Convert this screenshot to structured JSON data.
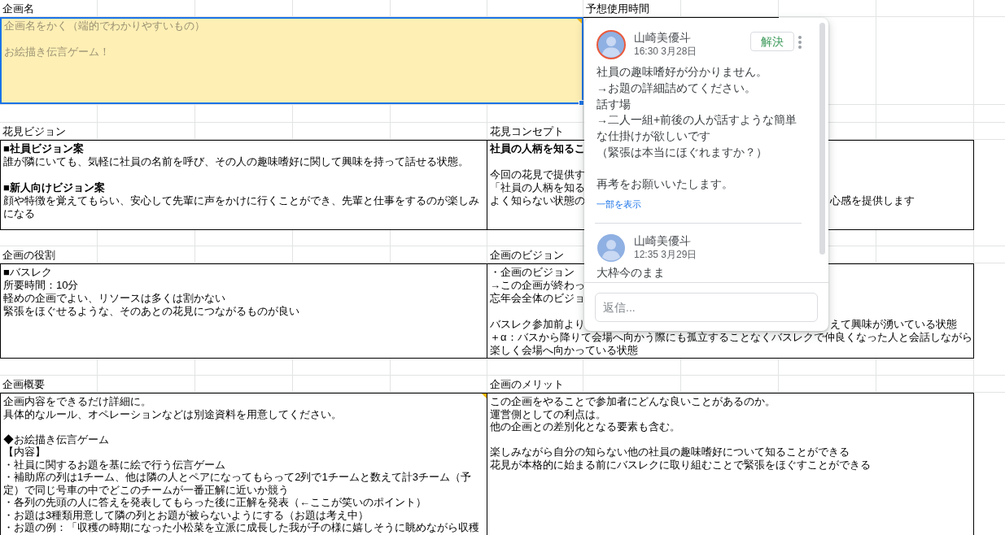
{
  "sheet": {
    "title_block": {
      "heading": "企画名",
      "paragraphs": [
        {
          "lines": [
            "企画名をかく（端的でわかりやすいもの）"
          ]
        },
        {
          "lines": [
            "お絵描き伝言ゲーム！"
          ]
        }
      ],
      "selected": true,
      "has_comment": true
    },
    "time_block": {
      "heading": "予想使用時間"
    },
    "pairs": [
      {
        "left": {
          "heading": "花見ビジョン",
          "paragraphs": [
            {
              "title": "■社員ビジョン案",
              "lines": [
                "誰が隣にいても、気軽に社員の名前を呼び、その人の趣味嗜好に関して興味を持って話せる状態。"
              ]
            },
            {
              "title": "■新人向けビジョン案",
              "lines": [
                "顔や特徴を覚えてもらい、安心して先輩に声をかけに行くことができ、先輩と仕事をするのが楽しみになる"
              ]
            }
          ],
          "selected": false,
          "has_comment": false
        },
        "right": {
          "heading": "花見コンセプト",
          "paragraphs": [
            {
              "title": "社員の人柄を知るこ"
            },
            {
              "lines": [
                "今回の花見で提供す",
                "「社員の人柄を知る",
                "よく知らない状態の"
              ]
            }
          ],
          "text_beside_comment": "心感を提供します",
          "selected": false,
          "has_comment": false
        }
      },
      {
        "left": {
          "heading": "企画の役割",
          "paragraphs": [
            {
              "lines": [
                "■バスレク",
                "所要時間：10分",
                "軽めの企画でよい、リソースは多くは割かない",
                "緊張をほぐせるような、そのあとの花見につながるものが良い"
              ]
            }
          ],
          "selected": false,
          "has_comment": false
        },
        "right": {
          "heading": "企画のビジョン",
          "paragraphs": [
            {
              "lines": [
                "・企画のビジョン",
                "→この企画が終わっ",
                "忘年会全体のビジョ"
              ]
            },
            {
              "lines": [
                "バスレク参加前より"
              ]
            }
          ],
          "text_beside_comment": "えて興味が湧いている状態",
          "lines_below_comment": [
            "＋α：バスから降りて会場へ向かう際にも孤立することなくバスレクで仲良くなった人と会話しながら楽しく会場へ向かっている状態"
          ],
          "selected": false,
          "has_comment": false
        }
      },
      {
        "left": {
          "heading": "企画概要",
          "paragraphs": [
            {
              "lines": [
                "企画内容をできるだけ詳細に。",
                "具体的なルール、オペレーションなどは別途資料を用意してください。"
              ]
            },
            {
              "lines": [
                "◆お絵描き伝言ゲーム",
                "【内容】",
                "・社員に関するお題を基に絵で行う伝言ゲーム",
                "・補助席の列は1チーム、他は隣の人とペアになってもらって2列で1チームと数えて計3チーム（予定）で同じ号車の中でどこのチームが一番正解に近いか競う",
                "・各列の先頭の人に答えを発表してもらった後に正解を発表（←ここが笑いのポイント）",
                "・お題は3種類用意して隣の列とお題が被らないようにする（お題は考え中）",
                "・お題の例：「収穫の時期になった小松菜を立派に成長した我が子の様に嬉しそうに眺めながら収穫"
              ]
            }
          ],
          "selected": false,
          "has_comment": true
        },
        "right": {
          "heading": "企画のメリット",
          "paragraphs": [
            {
              "lines": [
                "この企画をやることで参加者にどんな良いことがあるのか。",
                "運営側としての利点は。",
                "他の企画との差別化となる要素も含む。"
              ]
            },
            {
              "lines": [
                "楽しみながら自分の知らない他の社員の趣味嗜好について知ることができる",
                "花見が本格的に始まる前にバスレクに取り組むことで緊張をほぐすことができる"
              ]
            }
          ],
          "selected": false,
          "has_comment": false
        }
      }
    ]
  },
  "comment_thread": {
    "comments": [
      {
        "kind": "thread_start",
        "author": "山崎美優斗",
        "time": "16:30 3月28日",
        "avatar_ring": true,
        "resolve_label": "解決",
        "paragraphs": [
          {
            "lines": [
              "社員の趣味嗜好が分かりません。",
              "→お題の詳細詰めてください。",
              "話す場",
              "→二人一組+前後の人が話すような簡単な仕掛けが欲しいです",
              "（緊張は本当にほぐれますか？）"
            ]
          },
          {
            "lines": [
              "再考をお願いいたします。"
            ]
          }
        ],
        "show_more": "一部を表示"
      },
      {
        "kind": "reply",
        "author": "山崎美優斗",
        "time": "12:35 3月29日",
        "avatar_ring": false,
        "paragraphs": [
          {
            "lines": [
              "大枠今のまま"
            ]
          }
        ]
      }
    ],
    "reply_placeholder": "返信..."
  }
}
